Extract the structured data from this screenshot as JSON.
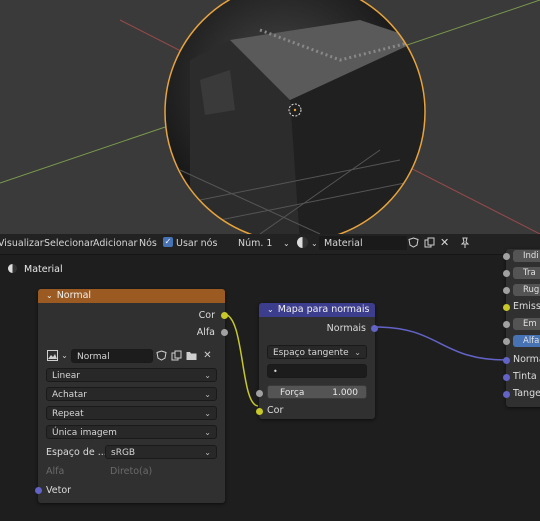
{
  "colors": {
    "frame_node_orange": "#9a5a22",
    "normal_map_node_purple": "#3d3d8e",
    "color_socket_yellow": "#c7c729",
    "float_socket_gray": "#a1a1a1",
    "vector_socket_purple": "#6363c7",
    "selection_orange": "#e8a33c",
    "active_blue": "#4772b3"
  },
  "header": {
    "menu": [
      "Visualizar",
      "Selecionar",
      "Adicionar",
      "Nós"
    ],
    "use_nodes_label": "Usar nós",
    "use_nodes_checked": true,
    "slot_label": "Núm. 1",
    "material_name": "Material"
  },
  "breadcrumb": {
    "label": "Material"
  },
  "image_node": {
    "title": "Normal",
    "outputs": [
      "Cor",
      "Alfa"
    ],
    "image_name": "Normal",
    "interpolation": "Linear",
    "projection": "Achatar",
    "extension": "Repeat",
    "source": "Única imagem",
    "color_space_label": "Espaço de ...",
    "color_space_value": "sRGB",
    "alpha_label": "Alfa",
    "alpha_value": "Direto(a)",
    "input": "Vetor"
  },
  "normal_map_node": {
    "title": "Mapa para normais",
    "output": "Normais",
    "space": "Espaço tangente",
    "uv_map": "",
    "strength_label": "Força",
    "strength_value": "1.000",
    "input": "Cor"
  },
  "bsdf_node": {
    "inputs": [
      "Indi",
      "Tra",
      "Rug",
      "Emiss",
      "Em",
      "Alfa",
      "Norma",
      "Tinta p",
      "Tange"
    ]
  }
}
